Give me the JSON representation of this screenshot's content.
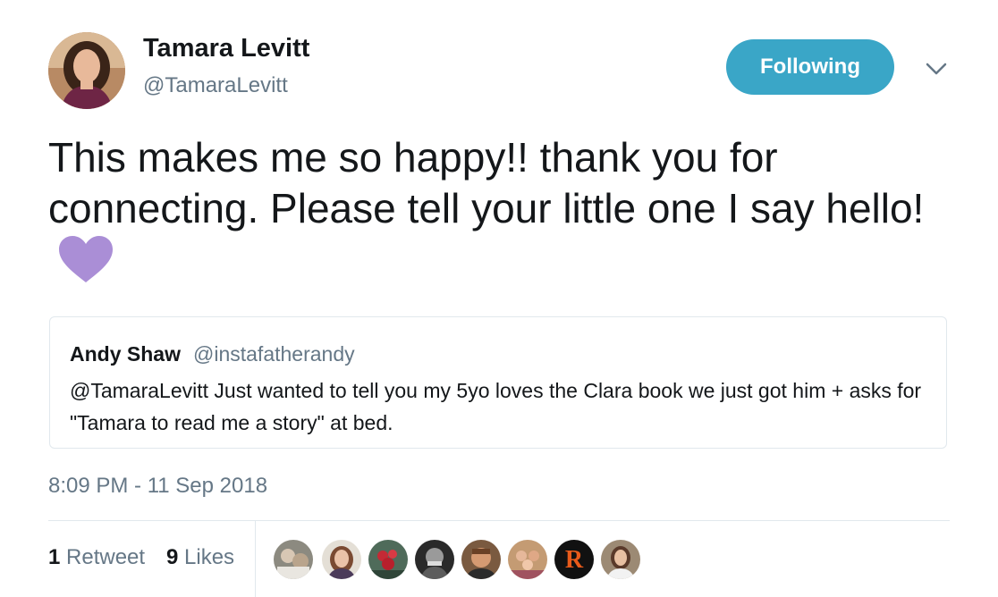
{
  "author": {
    "name": "Tamara Levitt",
    "handle": "@TamaraLevitt"
  },
  "follow_button_label": "Following",
  "tweet": {
    "text": "This makes me so happy!! thank you for connecting. Please tell your little one I say hello!",
    "emoji_icon": "purple-heart-icon"
  },
  "quoted_tweet": {
    "name": "Andy Shaw",
    "handle": "@instafatherandy",
    "text": "@TamaraLevitt Just wanted to tell you my 5yo loves the Clara book we just got him + asks for \"Tamara to read me a story\" at bed."
  },
  "timestamp": "8:09 PM - 11 Sep 2018",
  "stats": {
    "retweets_count": "1",
    "retweets_label": "Retweet",
    "likes_count": "9",
    "likes_label": "Likes"
  },
  "colors": {
    "follow_button": "#3aa6c7",
    "heart": "#aa8ed6",
    "secondary_text": "#657786"
  }
}
